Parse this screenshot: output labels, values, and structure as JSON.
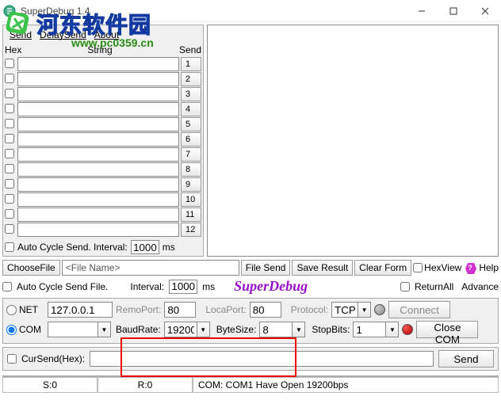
{
  "window": {
    "title": "SuperDebug 1.4"
  },
  "watermark": {
    "text": "河东软件园",
    "url": "www.pc0359.cn"
  },
  "menu": {
    "send": "Send",
    "delaySend": "DelaySend",
    "about": "About"
  },
  "cols": {
    "hex": "Hex",
    "string": "String",
    "send": "Send"
  },
  "rows": [
    "1",
    "2",
    "3",
    "4",
    "5",
    "6",
    "7",
    "8",
    "9",
    "10",
    "11",
    "12"
  ],
  "auto": {
    "label": "Auto Cycle Send. Interval:",
    "val": "1000",
    "ms": "ms"
  },
  "filebar": {
    "choose": "ChooseFile",
    "name": "<File Name>",
    "filesend": "File Send",
    "save": "Save Result",
    "clear": "Clear Form",
    "hexview": "HexView",
    "help": "Help"
  },
  "filebar2": {
    "auto": "Auto Cycle Send File.",
    "interval": "Interval:",
    "val": "1000",
    "ms": "ms",
    "logo": "SuperDebug",
    "retall": "ReturnAll",
    "adv": "Advance"
  },
  "net": {
    "netLbl": "NET",
    "netAddr": "127.0.0.1",
    "remoPort": "RemoPort:",
    "remoVal": "80",
    "locaPort": "LocaPort:",
    "locaVal": "80",
    "protocol": "Protocol:",
    "protoVal": "TCP",
    "connect": "Connect",
    "comLbl": "COM",
    "baud": "BaudRate:",
    "baudVal": "19200",
    "byte": "ByteSize:",
    "byteVal": "8",
    "stop": "StopBits:",
    "stopVal": "1",
    "close": "Close COM"
  },
  "cursend": {
    "label": "CurSend(Hex):",
    "send": "Send"
  },
  "status": {
    "s": "S:0",
    "r": "R:0",
    "com": "COM: COM1 Have Open 19200bps"
  }
}
